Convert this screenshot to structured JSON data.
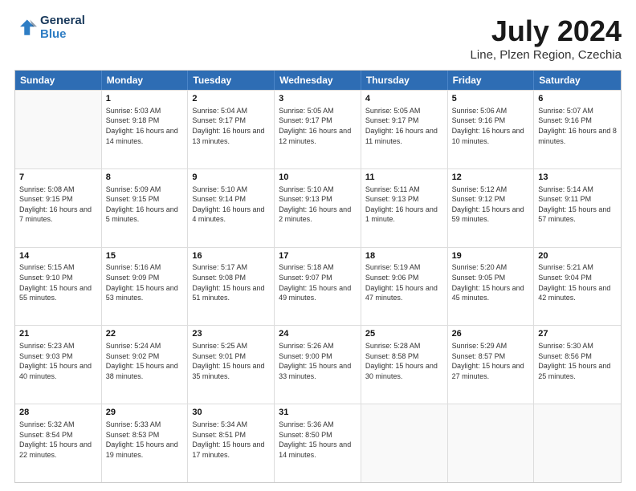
{
  "logo": {
    "line1": "General",
    "line2": "Blue"
  },
  "title": "July 2024",
  "subtitle": "Line, Plzen Region, Czechia",
  "header_days": [
    "Sunday",
    "Monday",
    "Tuesday",
    "Wednesday",
    "Thursday",
    "Friday",
    "Saturday"
  ],
  "weeks": [
    [
      {
        "day": "",
        "sunrise": "",
        "sunset": "",
        "daylight": ""
      },
      {
        "day": "1",
        "sunrise": "Sunrise: 5:03 AM",
        "sunset": "Sunset: 9:18 PM",
        "daylight": "Daylight: 16 hours and 14 minutes."
      },
      {
        "day": "2",
        "sunrise": "Sunrise: 5:04 AM",
        "sunset": "Sunset: 9:17 PM",
        "daylight": "Daylight: 16 hours and 13 minutes."
      },
      {
        "day": "3",
        "sunrise": "Sunrise: 5:05 AM",
        "sunset": "Sunset: 9:17 PM",
        "daylight": "Daylight: 16 hours and 12 minutes."
      },
      {
        "day": "4",
        "sunrise": "Sunrise: 5:05 AM",
        "sunset": "Sunset: 9:17 PM",
        "daylight": "Daylight: 16 hours and 11 minutes."
      },
      {
        "day": "5",
        "sunrise": "Sunrise: 5:06 AM",
        "sunset": "Sunset: 9:16 PM",
        "daylight": "Daylight: 16 hours and 10 minutes."
      },
      {
        "day": "6",
        "sunrise": "Sunrise: 5:07 AM",
        "sunset": "Sunset: 9:16 PM",
        "daylight": "Daylight: 16 hours and 8 minutes."
      }
    ],
    [
      {
        "day": "7",
        "sunrise": "Sunrise: 5:08 AM",
        "sunset": "Sunset: 9:15 PM",
        "daylight": "Daylight: 16 hours and 7 minutes."
      },
      {
        "day": "8",
        "sunrise": "Sunrise: 5:09 AM",
        "sunset": "Sunset: 9:15 PM",
        "daylight": "Daylight: 16 hours and 5 minutes."
      },
      {
        "day": "9",
        "sunrise": "Sunrise: 5:10 AM",
        "sunset": "Sunset: 9:14 PM",
        "daylight": "Daylight: 16 hours and 4 minutes."
      },
      {
        "day": "10",
        "sunrise": "Sunrise: 5:10 AM",
        "sunset": "Sunset: 9:13 PM",
        "daylight": "Daylight: 16 hours and 2 minutes."
      },
      {
        "day": "11",
        "sunrise": "Sunrise: 5:11 AM",
        "sunset": "Sunset: 9:13 PM",
        "daylight": "Daylight: 16 hours and 1 minute."
      },
      {
        "day": "12",
        "sunrise": "Sunrise: 5:12 AM",
        "sunset": "Sunset: 9:12 PM",
        "daylight": "Daylight: 15 hours and 59 minutes."
      },
      {
        "day": "13",
        "sunrise": "Sunrise: 5:14 AM",
        "sunset": "Sunset: 9:11 PM",
        "daylight": "Daylight: 15 hours and 57 minutes."
      }
    ],
    [
      {
        "day": "14",
        "sunrise": "Sunrise: 5:15 AM",
        "sunset": "Sunset: 9:10 PM",
        "daylight": "Daylight: 15 hours and 55 minutes."
      },
      {
        "day": "15",
        "sunrise": "Sunrise: 5:16 AM",
        "sunset": "Sunset: 9:09 PM",
        "daylight": "Daylight: 15 hours and 53 minutes."
      },
      {
        "day": "16",
        "sunrise": "Sunrise: 5:17 AM",
        "sunset": "Sunset: 9:08 PM",
        "daylight": "Daylight: 15 hours and 51 minutes."
      },
      {
        "day": "17",
        "sunrise": "Sunrise: 5:18 AM",
        "sunset": "Sunset: 9:07 PM",
        "daylight": "Daylight: 15 hours and 49 minutes."
      },
      {
        "day": "18",
        "sunrise": "Sunrise: 5:19 AM",
        "sunset": "Sunset: 9:06 PM",
        "daylight": "Daylight: 15 hours and 47 minutes."
      },
      {
        "day": "19",
        "sunrise": "Sunrise: 5:20 AM",
        "sunset": "Sunset: 9:05 PM",
        "daylight": "Daylight: 15 hours and 45 minutes."
      },
      {
        "day": "20",
        "sunrise": "Sunrise: 5:21 AM",
        "sunset": "Sunset: 9:04 PM",
        "daylight": "Daylight: 15 hours and 42 minutes."
      }
    ],
    [
      {
        "day": "21",
        "sunrise": "Sunrise: 5:23 AM",
        "sunset": "Sunset: 9:03 PM",
        "daylight": "Daylight: 15 hours and 40 minutes."
      },
      {
        "day": "22",
        "sunrise": "Sunrise: 5:24 AM",
        "sunset": "Sunset: 9:02 PM",
        "daylight": "Daylight: 15 hours and 38 minutes."
      },
      {
        "day": "23",
        "sunrise": "Sunrise: 5:25 AM",
        "sunset": "Sunset: 9:01 PM",
        "daylight": "Daylight: 15 hours and 35 minutes."
      },
      {
        "day": "24",
        "sunrise": "Sunrise: 5:26 AM",
        "sunset": "Sunset: 9:00 PM",
        "daylight": "Daylight: 15 hours and 33 minutes."
      },
      {
        "day": "25",
        "sunrise": "Sunrise: 5:28 AM",
        "sunset": "Sunset: 8:58 PM",
        "daylight": "Daylight: 15 hours and 30 minutes."
      },
      {
        "day": "26",
        "sunrise": "Sunrise: 5:29 AM",
        "sunset": "Sunset: 8:57 PM",
        "daylight": "Daylight: 15 hours and 27 minutes."
      },
      {
        "day": "27",
        "sunrise": "Sunrise: 5:30 AM",
        "sunset": "Sunset: 8:56 PM",
        "daylight": "Daylight: 15 hours and 25 minutes."
      }
    ],
    [
      {
        "day": "28",
        "sunrise": "Sunrise: 5:32 AM",
        "sunset": "Sunset: 8:54 PM",
        "daylight": "Daylight: 15 hours and 22 minutes."
      },
      {
        "day": "29",
        "sunrise": "Sunrise: 5:33 AM",
        "sunset": "Sunset: 8:53 PM",
        "daylight": "Daylight: 15 hours and 19 minutes."
      },
      {
        "day": "30",
        "sunrise": "Sunrise: 5:34 AM",
        "sunset": "Sunset: 8:51 PM",
        "daylight": "Daylight: 15 hours and 17 minutes."
      },
      {
        "day": "31",
        "sunrise": "Sunrise: 5:36 AM",
        "sunset": "Sunset: 8:50 PM",
        "daylight": "Daylight: 15 hours and 14 minutes."
      },
      {
        "day": "",
        "sunrise": "",
        "sunset": "",
        "daylight": ""
      },
      {
        "day": "",
        "sunrise": "",
        "sunset": "",
        "daylight": ""
      },
      {
        "day": "",
        "sunrise": "",
        "sunset": "",
        "daylight": ""
      }
    ]
  ]
}
